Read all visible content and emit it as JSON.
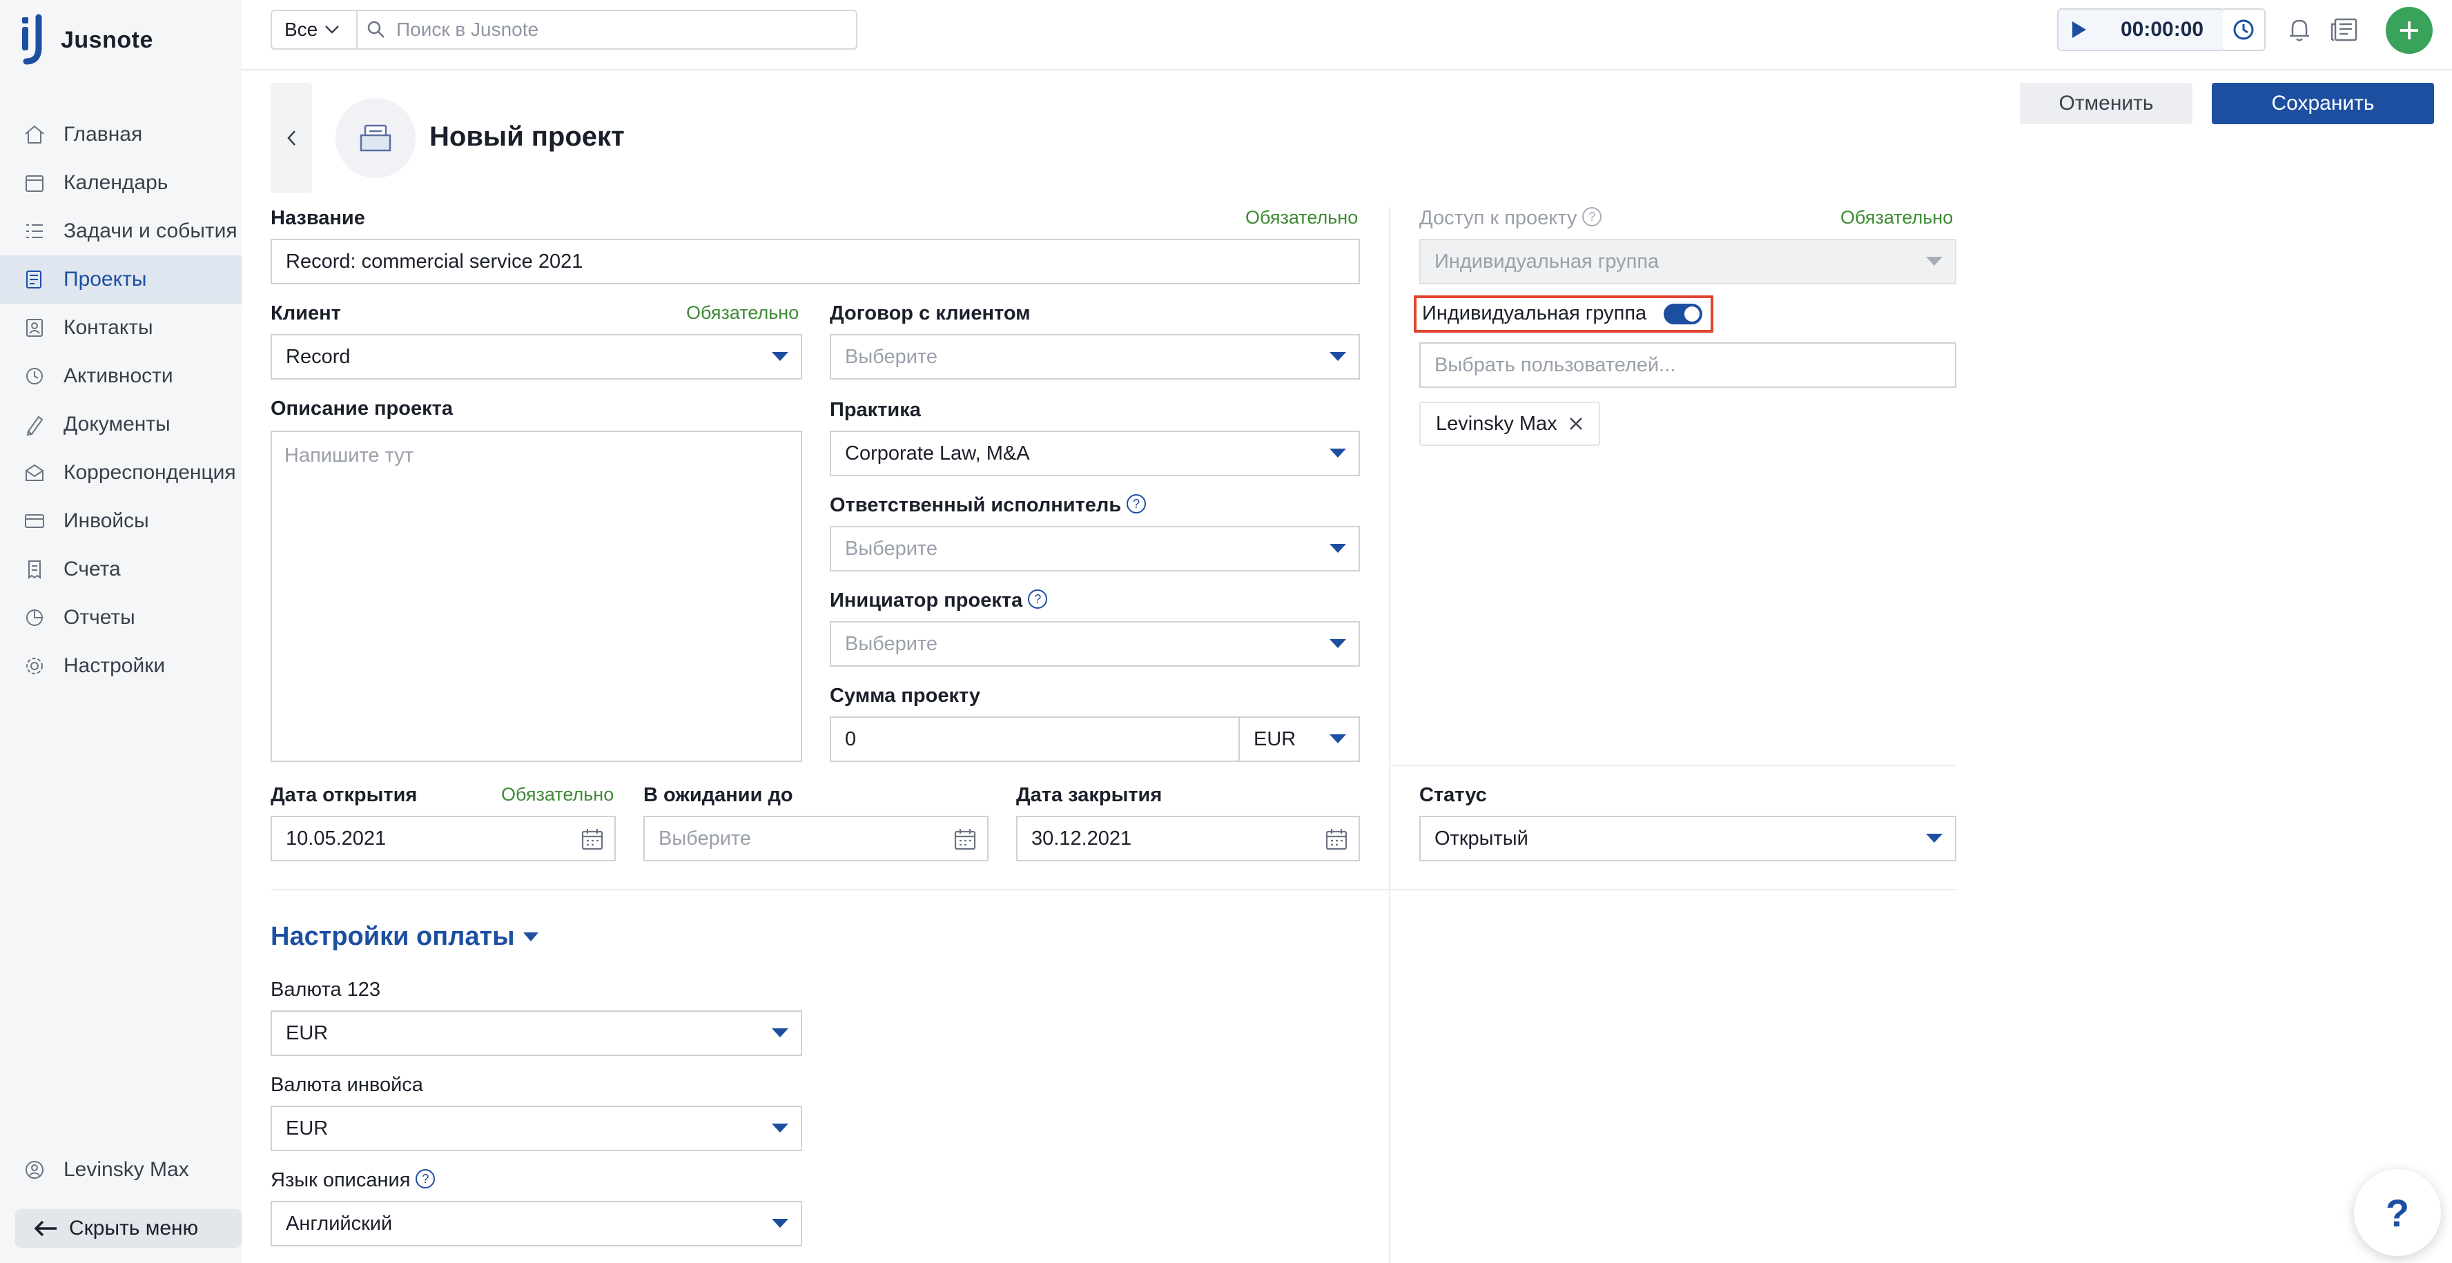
{
  "app": {
    "name": "Jusnote"
  },
  "sidebar": {
    "items": [
      {
        "label": "Главная",
        "icon": "home-icon"
      },
      {
        "label": "Календарь",
        "icon": "calendar-icon"
      },
      {
        "label": "Задачи и события",
        "icon": "tasks-icon"
      },
      {
        "label": "Проекты",
        "icon": "projects-icon",
        "active": true
      },
      {
        "label": "Контакты",
        "icon": "contacts-icon"
      },
      {
        "label": "Активности",
        "icon": "activity-icon"
      },
      {
        "label": "Документы",
        "icon": "documents-icon"
      },
      {
        "label": "Корреспонденция",
        "icon": "mail-icon"
      },
      {
        "label": "Инвойсы",
        "icon": "invoice-icon"
      },
      {
        "label": "Счета",
        "icon": "accounts-icon"
      },
      {
        "label": "Отчеты",
        "icon": "reports-icon"
      },
      {
        "label": "Настройки",
        "icon": "settings-icon"
      }
    ],
    "user": "Levinsky Max",
    "hide_menu": "Скрыть меню"
  },
  "topbar": {
    "scope": "Все",
    "search_placeholder": "Поиск в Jusnote",
    "timer": "00:00:00"
  },
  "header": {
    "title": "Новый проект",
    "cancel": "Отменить",
    "save": "Сохранить"
  },
  "form": {
    "required": "Обязательно",
    "name": {
      "label": "Название",
      "value": "Record: commercial service 2021"
    },
    "client": {
      "label": "Клиент",
      "value": "Record"
    },
    "contract": {
      "label": "Договор с клиентом",
      "placeholder": "Выберите"
    },
    "description": {
      "label": "Описание проекта",
      "placeholder": "Напишите тут"
    },
    "practice": {
      "label": "Практика",
      "value": "Corporate Law, M&A"
    },
    "responsible": {
      "label": "Ответственный исполнитель",
      "placeholder": "Выберите"
    },
    "initiator": {
      "label": "Инициатор проекта",
      "placeholder": "Выберите"
    },
    "amount": {
      "label": "Сумма проекту",
      "value": "0",
      "currency": "EUR"
    },
    "open_date": {
      "label": "Дата открытия",
      "value": "10.05.2021"
    },
    "pending_until": {
      "label": "В ожидании до",
      "placeholder": "Выберите"
    },
    "close_date": {
      "label": "Дата закрытия",
      "value": "30.12.2021"
    },
    "status": {
      "label": "Статус",
      "value": "Открытый"
    },
    "access": {
      "label": "Доступ к проекту",
      "value": "Индивидуальная группа",
      "toggle_label": "Индивидуальная группа",
      "toggle_on": true,
      "users_placeholder": "Выбрать пользователей...",
      "chips": [
        "Levinsky Max"
      ]
    }
  },
  "payment": {
    "title": "Настройки оплаты",
    "currency": {
      "label": "Валюта 123",
      "value": "EUR"
    },
    "invoice_currency": {
      "label": "Валюта инвойса",
      "value": "EUR"
    },
    "description_lang": {
      "label": "Язык описания",
      "value": "Английский"
    }
  },
  "help_fab": "?"
}
